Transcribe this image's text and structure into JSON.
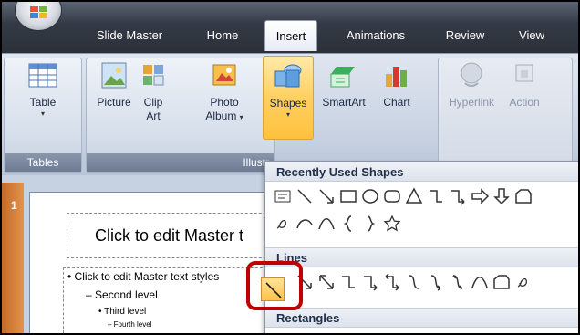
{
  "tabs": [
    {
      "label": "Slide Master",
      "active": false
    },
    {
      "label": "Home",
      "active": false
    },
    {
      "label": "Insert",
      "active": true
    },
    {
      "label": "Animations",
      "active": false
    },
    {
      "label": "Review",
      "active": false
    },
    {
      "label": "View",
      "active": false
    }
  ],
  "ribbon": {
    "groups": [
      {
        "title": "Tables"
      },
      {
        "title": "Illustr"
      }
    ],
    "buttons": {
      "table": {
        "label": "Table",
        "icon": "table-icon"
      },
      "picture": {
        "label": "Picture",
        "icon": "picture-icon"
      },
      "clipart": {
        "label1": "Clip",
        "label2": "Art",
        "icon": "clipart-icon"
      },
      "photo": {
        "label1": "Photo",
        "label2": "Album",
        "icon": "photo-album-icon"
      },
      "shapes": {
        "label": "Shapes",
        "icon": "shapes-icon"
      },
      "smartart": {
        "label": "SmartArt",
        "icon": "smartart-icon"
      },
      "chart": {
        "label": "Chart",
        "icon": "chart-icon"
      },
      "hyperlink": {
        "label": "Hyperlink",
        "icon": "hyperlink-icon"
      },
      "action": {
        "label": "Action",
        "icon": "action-icon"
      }
    }
  },
  "slide": {
    "number": "1",
    "title": "Click to edit Master t",
    "body": {
      "level1": "Click to edit Master text styles",
      "level2": "Second level",
      "level3": "Third level",
      "level4": "Fourth level"
    }
  },
  "gallery": {
    "sections": {
      "recent": "Recently Used Shapes",
      "lines": "Lines",
      "rectangles": "Rectangles"
    }
  },
  "colors": {
    "accent_highlight": "#c00000",
    "selected_button": "#ffd061"
  }
}
